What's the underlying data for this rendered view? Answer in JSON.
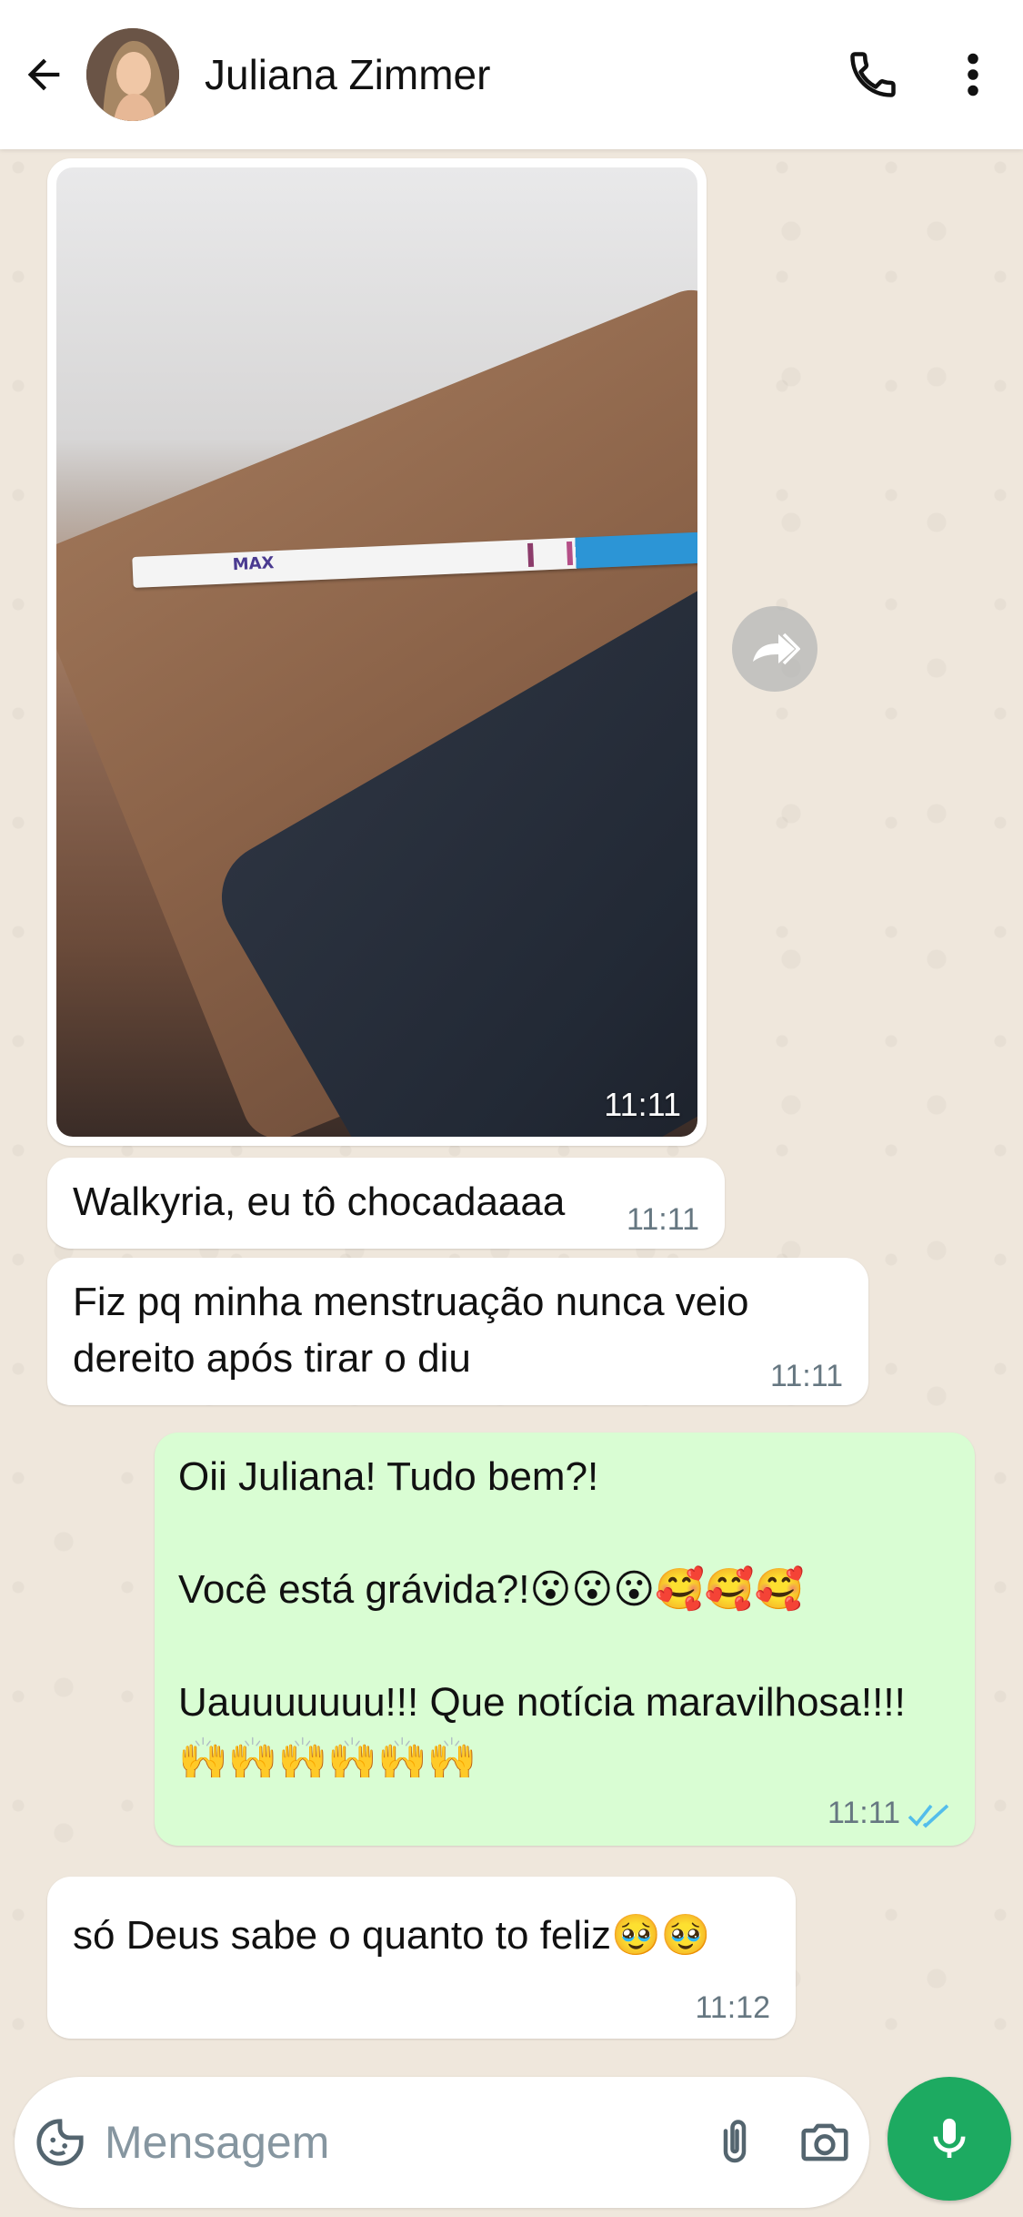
{
  "header": {
    "contact_name": "Juliana Zimmer",
    "back_icon": "arrow-left-icon",
    "call_icon": "phone-icon",
    "menu_icon": "more-vertical-icon"
  },
  "messages": [
    {
      "type": "image",
      "direction": "incoming",
      "time": "11:11",
      "strip_label": "MAX"
    },
    {
      "type": "text",
      "direction": "incoming",
      "text": "Walkyria, eu tô chocadaaaa",
      "time": "11:11"
    },
    {
      "type": "text",
      "direction": "incoming",
      "text": "Fiz pq minha menstruação nunca veio\ndereito após tirar o diu",
      "time": "11:11"
    },
    {
      "type": "text",
      "direction": "outgoing",
      "text": "Oii Juliana! Tudo bem?!\n\nVocê está grávida?!😮😮😮🥰🥰🥰\n\nUauuuuuuu!!! Que notícia maravilhosa!!!!\n🙌🙌🙌🙌🙌🙌",
      "time": "11:11",
      "status": "read"
    },
    {
      "type": "text",
      "direction": "incoming",
      "text": "só Deus sabe o quanto to feliz🥹🥹",
      "time": "11:12"
    }
  ],
  "composer": {
    "placeholder": "Mensagem",
    "emoji_icon": "sticker-icon",
    "attach_icon": "paperclip-icon",
    "camera_icon": "camera-icon",
    "mic_icon": "microphone-icon"
  },
  "colors": {
    "outgoing_bubble": "#d9fdd3",
    "incoming_bubble": "#ffffff",
    "read_ticks": "#53bdeb",
    "mic_button": "#1daa61",
    "wallpaper": "#efe7dc"
  }
}
